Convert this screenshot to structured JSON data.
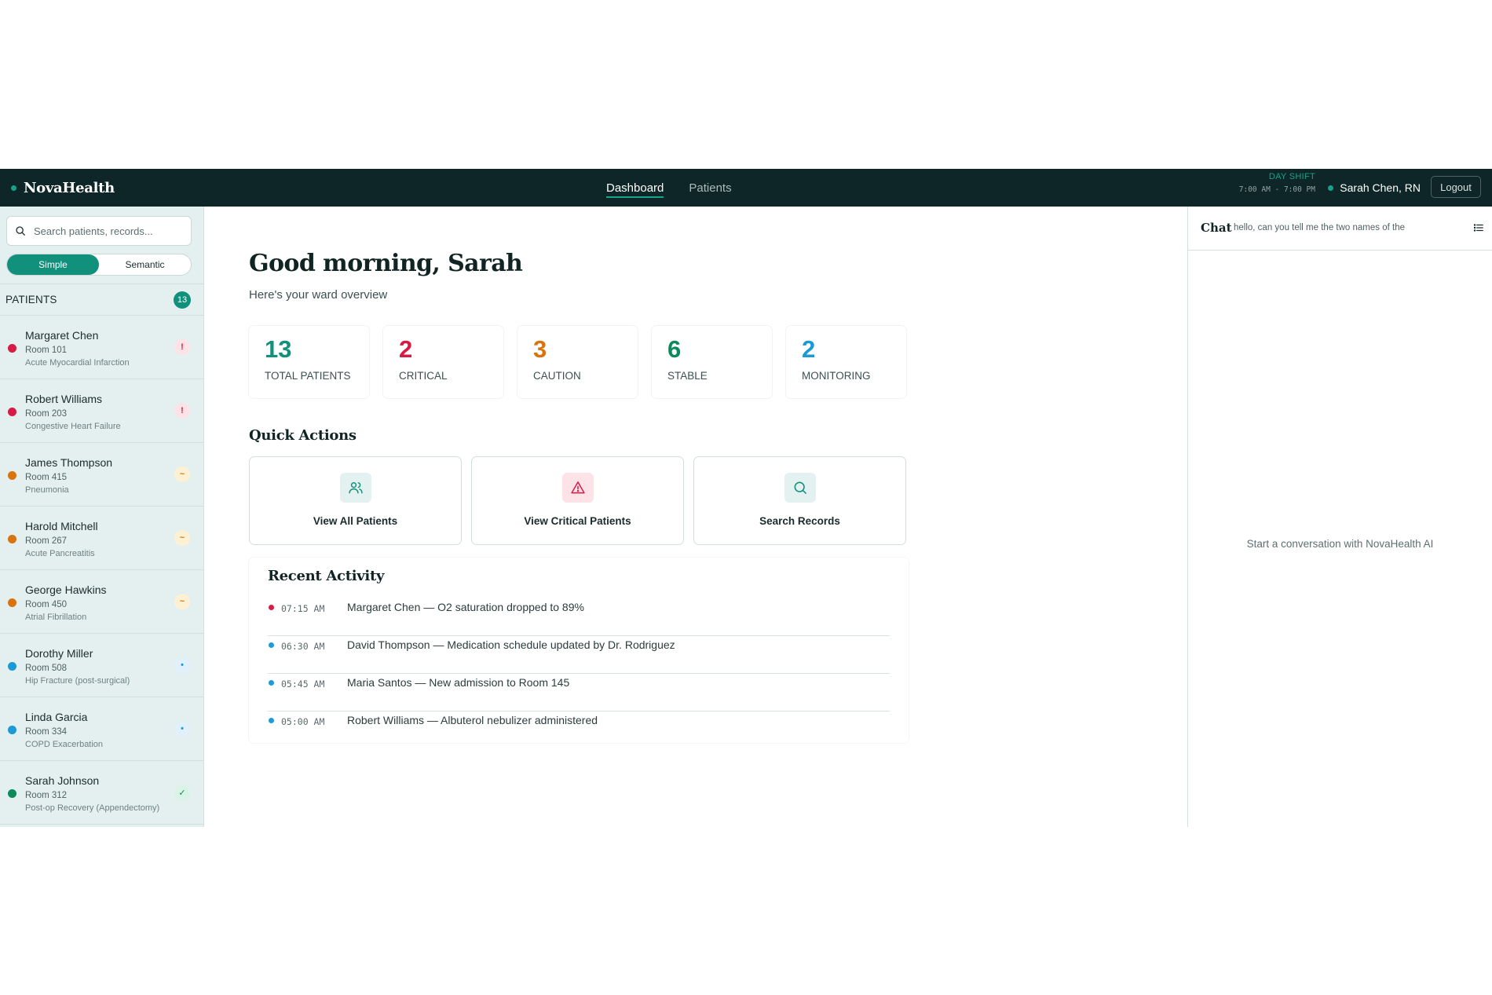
{
  "app": {
    "brand": "NovaHealth"
  },
  "nav": {
    "tabs": [
      {
        "label": "Dashboard"
      },
      {
        "label": "Patients"
      }
    ]
  },
  "shift": {
    "label": "DAY SHIFT",
    "time": "7:00 AM - 7:00 PM"
  },
  "user": {
    "name": "Sarah Chen, RN",
    "logout_label": "Logout"
  },
  "sidebar": {
    "search_placeholder": "Search patients, records...",
    "modes": [
      "Simple",
      "Semantic"
    ],
    "active_mode": "Simple",
    "patients_title": "PATIENTS",
    "patients_count": "13",
    "patients": [
      {
        "name": "Margaret Chen",
        "room": "Room 101",
        "diagnosis": "Acute Myocardial Infarction",
        "status": "critical",
        "badge": "!"
      },
      {
        "name": "Robert Williams",
        "room": "Room 203",
        "diagnosis": "Congestive Heart Failure",
        "status": "critical",
        "badge": "!"
      },
      {
        "name": "James Thompson",
        "room": "Room 415",
        "diagnosis": "Pneumonia",
        "status": "caution",
        "badge": "~"
      },
      {
        "name": "Harold Mitchell",
        "room": "Room 267",
        "diagnosis": "Acute Pancreatitis",
        "status": "caution",
        "badge": "~"
      },
      {
        "name": "George Hawkins",
        "room": "Room 450",
        "diagnosis": "Atrial Fibrillation",
        "status": "caution",
        "badge": "~"
      },
      {
        "name": "Dorothy Miller",
        "room": "Room 508",
        "diagnosis": "Hip Fracture (post-surgical)",
        "status": "monitoring",
        "badge": "•"
      },
      {
        "name": "Linda Garcia",
        "room": "Room 334",
        "diagnosis": "COPD Exacerbation",
        "status": "monitoring",
        "badge": "•"
      },
      {
        "name": "Sarah Johnson",
        "room": "Room 312",
        "diagnosis": "Post-op Recovery (Appendectomy)",
        "status": "stable",
        "badge": "✓"
      }
    ]
  },
  "main": {
    "greeting": "Good morning, Sarah",
    "subtitle": "Here's your ward overview",
    "stats": [
      {
        "value": "13",
        "label": "TOTAL PATIENTS",
        "color": "#11907c"
      },
      {
        "value": "2",
        "label": "CRITICAL",
        "color": "#d81b45"
      },
      {
        "value": "3",
        "label": "CAUTION",
        "color": "#d9730d"
      },
      {
        "value": "6",
        "label": "STABLE",
        "color": "#0b8a5c"
      },
      {
        "value": "2",
        "label": "MONITORING",
        "color": "#1c9ad6"
      }
    ],
    "quick_actions_title": "Quick Actions",
    "quick_actions": [
      {
        "label": "View All Patients",
        "icon": "users-icon"
      },
      {
        "label": "View Critical Patients",
        "icon": "alert-triangle-icon"
      },
      {
        "label": "Search Records",
        "icon": "search-icon"
      }
    ],
    "recent_activity_title": "Recent Activity",
    "recent_activity": [
      {
        "time": "07:15 AM",
        "text": "Margaret Chen — O2 saturation dropped to 89%",
        "color": "#d81b45"
      },
      {
        "time": "06:30 AM",
        "text": "David Thompson — Medication schedule updated by Dr. Rodriguez",
        "color": "#1c9ad6"
      },
      {
        "time": "05:45 AM",
        "text": "Maria Santos — New admission to Room 145",
        "color": "#1c9ad6"
      },
      {
        "time": "05:00 AM",
        "text": "Robert Williams — Albuterol nebulizer administered",
        "color": "#1c9ad6"
      }
    ]
  },
  "chat": {
    "title": "Chat",
    "preview": "hello, can you tell me the two names of the",
    "empty_text": "Start a conversation with NovaHealth AI"
  },
  "colors": {
    "critical": "#d81b45",
    "caution": "#d9730d",
    "stable": "#0b8a5c",
    "monitoring": "#1c9ad6",
    "accent": "#11907c"
  }
}
